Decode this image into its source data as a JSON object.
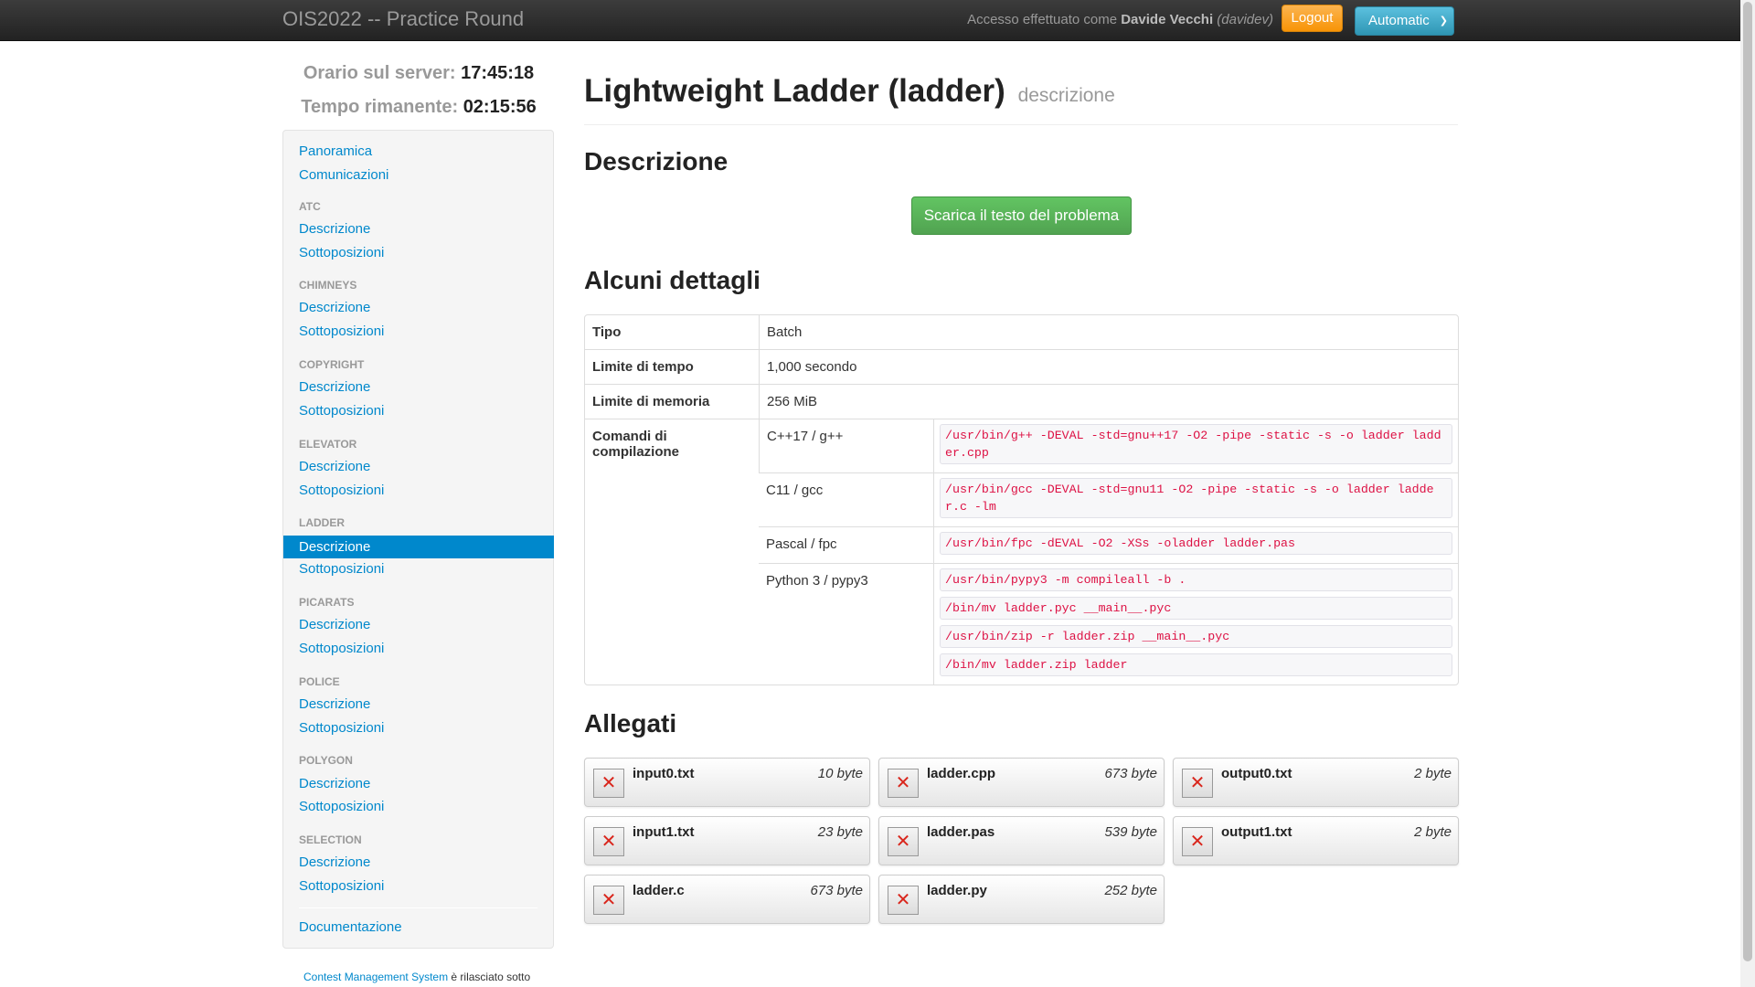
{
  "navbar": {
    "brand": "OIS2022 -- Practice Round",
    "login_prefix": "Accesso effettuato come",
    "user_name": "Davide Vecchi",
    "user_handle": "(davidev)",
    "logout": "Logout",
    "theme": "Automatic"
  },
  "clock": {
    "server_label": "Orario sul server:",
    "server_time": "17:45:18",
    "remaining_label": "Tempo rimanente:",
    "remaining_time": "02:15:56"
  },
  "sidebar": {
    "overview": "Panoramica",
    "communications": "Comunicazioni",
    "tasks": [
      {
        "name": "ATC",
        "desc": "Descrizione",
        "subs": "Sottoposizioni"
      },
      {
        "name": "CHIMNEYS",
        "desc": "Descrizione",
        "subs": "Sottoposizioni"
      },
      {
        "name": "COPYRIGHT",
        "desc": "Descrizione",
        "subs": "Sottoposizioni"
      },
      {
        "name": "ELEVATOR",
        "desc": "Descrizione",
        "subs": "Sottoposizioni"
      },
      {
        "name": "LADDER",
        "desc": "Descrizione",
        "subs": "Sottoposizioni"
      },
      {
        "name": "PICARATS",
        "desc": "Descrizione",
        "subs": "Sottoposizioni"
      },
      {
        "name": "POLICE",
        "desc": "Descrizione",
        "subs": "Sottoposizioni"
      },
      {
        "name": "POLYGON",
        "desc": "Descrizione",
        "subs": "Sottoposizioni"
      },
      {
        "name": "SELECTION",
        "desc": "Descrizione",
        "subs": "Sottoposizioni"
      }
    ],
    "active_task": "LADDER",
    "documentation": "Documentazione"
  },
  "footer": {
    "link": "Contest Management System",
    "text": " è rilasciato sotto"
  },
  "main": {
    "title": "Lightweight Ladder (ladder)",
    "subtitle": "descrizione",
    "description_heading": "Descrizione",
    "download_button": "Scarica il testo del problema",
    "details_heading": "Alcuni dettagli",
    "details": {
      "type_label": "Tipo",
      "type_value": "Batch",
      "time_label": "Limite di tempo",
      "time_value": "1,000 secondo",
      "memory_label": "Limite di memoria",
      "memory_value": "256 MiB",
      "compile_label": "Comandi di compilazione",
      "compilers": [
        {
          "lang": "C++17 / g++",
          "commands": [
            "/usr/bin/g++ -DEVAL -std=gnu++17 -O2 -pipe -static -s -o ladder ladder.cpp"
          ]
        },
        {
          "lang": "C11 / gcc",
          "commands": [
            "/usr/bin/gcc -DEVAL -std=gnu11 -O2 -pipe -static -s -o ladder ladder.c -lm"
          ]
        },
        {
          "lang": "Pascal / fpc",
          "commands": [
            "/usr/bin/fpc -dEVAL -O2 -XSs -oladder ladder.pas"
          ]
        },
        {
          "lang": "Python 3 / pypy3",
          "commands": [
            "/usr/bin/pypy3 -m compileall -b .",
            "/bin/mv ladder.pyc __main__.pyc",
            "/usr/bin/zip -r ladder.zip __main__.pyc",
            "/bin/mv ladder.zip ladder"
          ]
        }
      ]
    },
    "attachments_heading": "Allegati",
    "attachments": [
      {
        "name": "input0.txt",
        "size": "10 byte"
      },
      {
        "name": "ladder.cpp",
        "size": "673 byte"
      },
      {
        "name": "output0.txt",
        "size": "2 byte"
      },
      {
        "name": "input1.txt",
        "size": "23 byte"
      },
      {
        "name": "ladder.pas",
        "size": "539 byte"
      },
      {
        "name": "output1.txt",
        "size": "2 byte"
      },
      {
        "name": "ladder.c",
        "size": "673 byte"
      },
      {
        "name": "ladder.py",
        "size": "252 byte"
      }
    ]
  }
}
